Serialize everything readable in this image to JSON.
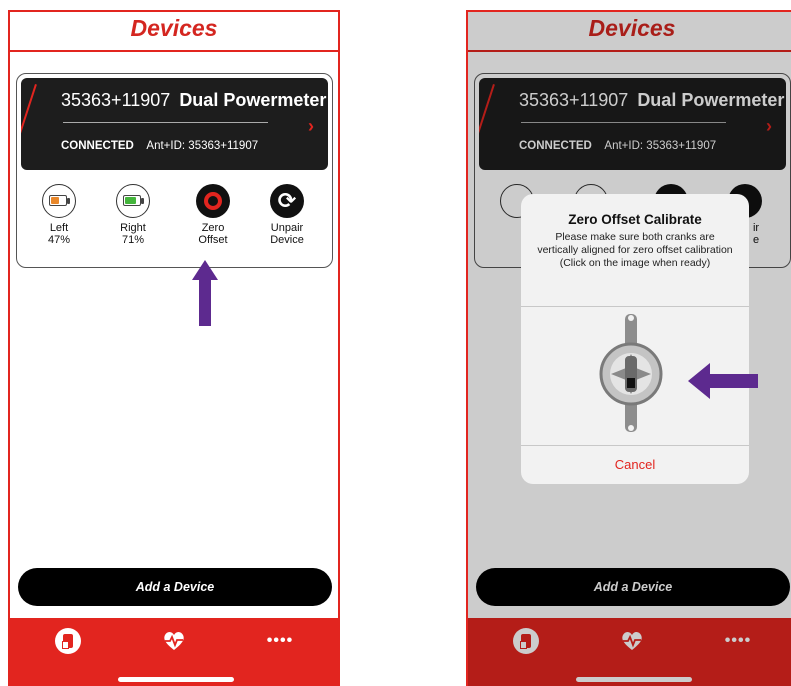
{
  "left": {
    "header": {
      "title": "Devices"
    },
    "device": {
      "id": "35363+11907",
      "name": "Dual Powermeter",
      "status": "CONNECTED",
      "ant_label": "Ant+ID:",
      "ant_id": "35363+11907",
      "chevron": "›"
    },
    "actions": [
      {
        "line1": "Left",
        "line2": "47%"
      },
      {
        "line1": "Right",
        "line2": "71%"
      },
      {
        "line1": "Zero",
        "line2": "Offset"
      },
      {
        "line1": "Unpair",
        "line2": "Device"
      }
    ],
    "add_button": "Add a Device",
    "tabbar": {
      "more": "••••"
    }
  },
  "right": {
    "header": {
      "title": "Devices"
    },
    "device": {
      "id": "35363+11907",
      "name": "Dual Powermeter",
      "status": "CONNECTED",
      "ant_label": "Ant+ID:",
      "ant_id": "35363+11907",
      "chevron": "›"
    },
    "partial_labels": {
      "a": "ir",
      "b": "e"
    },
    "modal": {
      "title": "Zero Offset Calibrate",
      "message": "Please make sure both cranks are vertically aligned for zero offset calibration (Click on the image when ready)",
      "cancel": "Cancel"
    },
    "add_button": "Add a Device",
    "tabbar": {
      "more": "••••"
    }
  },
  "battery": {
    "left_fraction": 0.47,
    "right_fraction": 0.71
  },
  "colors": {
    "brand_red": "#e2251f",
    "battery_low": "#e8872a",
    "battery_ok": "#44b53c",
    "annotation_arrow": "#5d2a8f"
  },
  "icons": [
    "battery-icon",
    "zero-offset-icon",
    "unpair-icon",
    "devices-tab-icon",
    "heart-rate-tab-icon",
    "more-tab-icon",
    "crankset-icon"
  ]
}
